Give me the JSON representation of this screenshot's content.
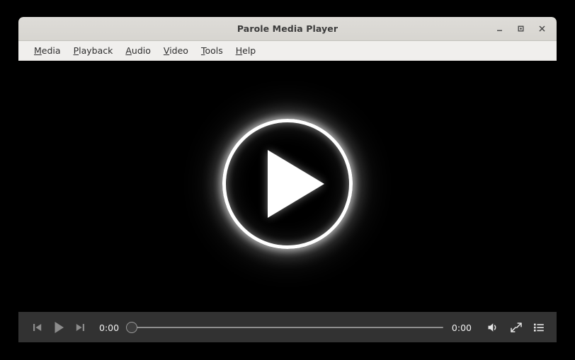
{
  "window": {
    "title": "Parole Media Player",
    "controls": [
      {
        "name": "minimize",
        "glyph": "minimize-icon"
      },
      {
        "name": "maximize",
        "glyph": "maximize-icon"
      },
      {
        "name": "close",
        "glyph": "close-icon"
      }
    ]
  },
  "menubar": {
    "items": [
      {
        "label": "Media",
        "mnemonic": "M",
        "rest": "edia"
      },
      {
        "label": "Playback",
        "mnemonic": "P",
        "rest": "layback"
      },
      {
        "label": "Audio",
        "mnemonic": "A",
        "rest": "udio"
      },
      {
        "label": "Video",
        "mnemonic": "V",
        "rest": "ideo"
      },
      {
        "label": "Tools",
        "mnemonic": "T",
        "rest": "ools"
      },
      {
        "label": "Help",
        "mnemonic": "H",
        "rest": "elp"
      }
    ]
  },
  "video": {
    "state": "stopped",
    "logo_icon": "play-circle-logo",
    "background_color": "#000000"
  },
  "controls": {
    "previous_icon": "previous-track-icon",
    "play_icon": "play-icon",
    "next_icon": "next-track-icon",
    "current_time": "0:00",
    "total_time": "0:00",
    "seek_position_percent": 0,
    "volume_icon": "volume-medium-icon",
    "fullscreen_icon": "fullscreen-icon",
    "playlist_icon": "playlist-icon"
  },
  "colors": {
    "titlebar": "#d8d6d2",
    "menubar": "#f0efed",
    "controlbar": "#323232",
    "video_background": "#000000",
    "icon_gray": "#8c8c8c",
    "text_light": "#f2f2f2",
    "text_dark": "#2e2e2e"
  }
}
